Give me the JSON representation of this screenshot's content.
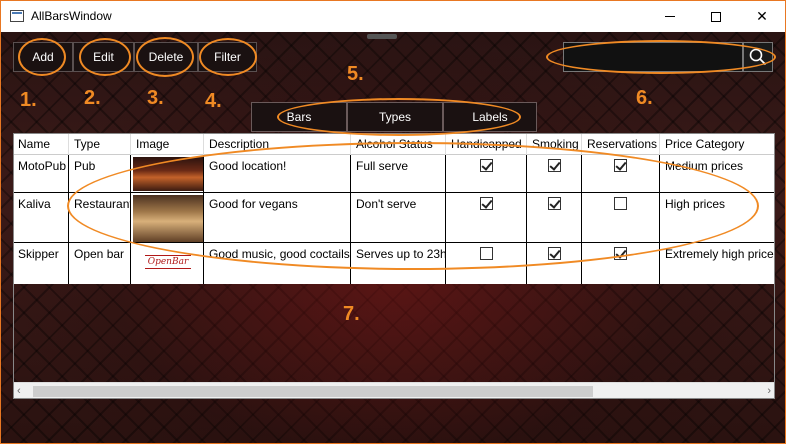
{
  "window": {
    "title": "AllBarsWindow",
    "minimize_glyph": "",
    "maximize_glyph": "",
    "close_glyph": "✕"
  },
  "toolbar": {
    "add_label": "Add",
    "edit_label": "Edit",
    "delete_label": "Delete",
    "filter_label": "Filter"
  },
  "search": {
    "value": "",
    "icon": "search-icon"
  },
  "tabs": [
    {
      "label": "Bars"
    },
    {
      "label": "Types"
    },
    {
      "label": "Labels"
    }
  ],
  "annotations": [
    "1.",
    "2.",
    "3.",
    "4.",
    "5.",
    "6.",
    "7."
  ],
  "table": {
    "columns": [
      "Name",
      "Type",
      "Image",
      "Description",
      "Alcohol Status",
      "Handicapped",
      "Smoking",
      "Reservations",
      "Price Category"
    ],
    "rows": [
      {
        "name": "MotoPub",
        "type": "Pub",
        "image": "pub-photo",
        "description": "Good location!",
        "alcohol": "Full serve",
        "handicapped": true,
        "smoking": true,
        "reservations": true,
        "price": "Medium prices"
      },
      {
        "name": "Kaliva",
        "type": "Restaurant",
        "image": "restaurant-photo",
        "description": "Good for vegans",
        "alcohol": "Don't serve",
        "handicapped": true,
        "smoking": true,
        "reservations": false,
        "price": "High prices"
      },
      {
        "name": "Skipper",
        "type": "Open bar",
        "image": "open-bar-logo",
        "logo_text": "OpenBar",
        "description": "Good music, good coctails",
        "alcohol": "Serves up to 23h",
        "handicapped": false,
        "smoking": true,
        "reservations": true,
        "price": "Extremely high price"
      }
    ]
  },
  "colors": {
    "annotation": "#f08a24",
    "button_bg": "#1a1111"
  }
}
